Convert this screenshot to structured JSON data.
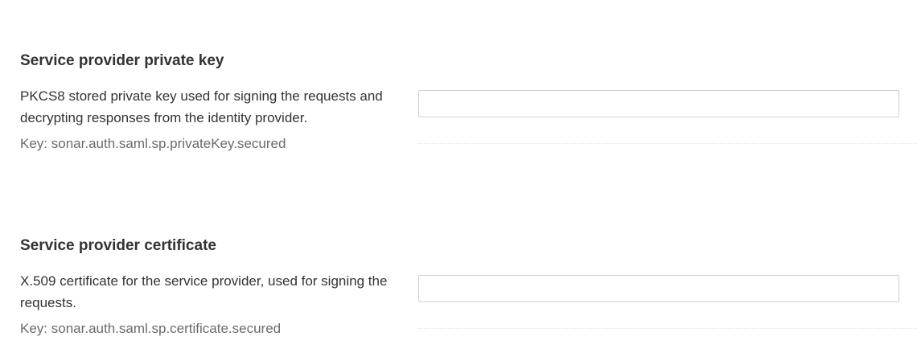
{
  "settings": [
    {
      "title": "Service provider private key",
      "description": "PKCS8 stored private key used for signing the requests and decrypting responses from the identity provider.",
      "key_label": "Key:",
      "key_value": "sonar.auth.saml.sp.privateKey.secured",
      "input_value": ""
    },
    {
      "title": "Service provider certificate",
      "description": "X.509 certificate for the service provider, used for signing the requests.",
      "key_label": "Key:",
      "key_value": "sonar.auth.saml.sp.certificate.secured",
      "input_value": ""
    }
  ],
  "colors": {
    "text": "#333333",
    "key_text": "#6b6b6b",
    "input_border": "#cfcfcf",
    "divider": "#e2e2e2"
  }
}
